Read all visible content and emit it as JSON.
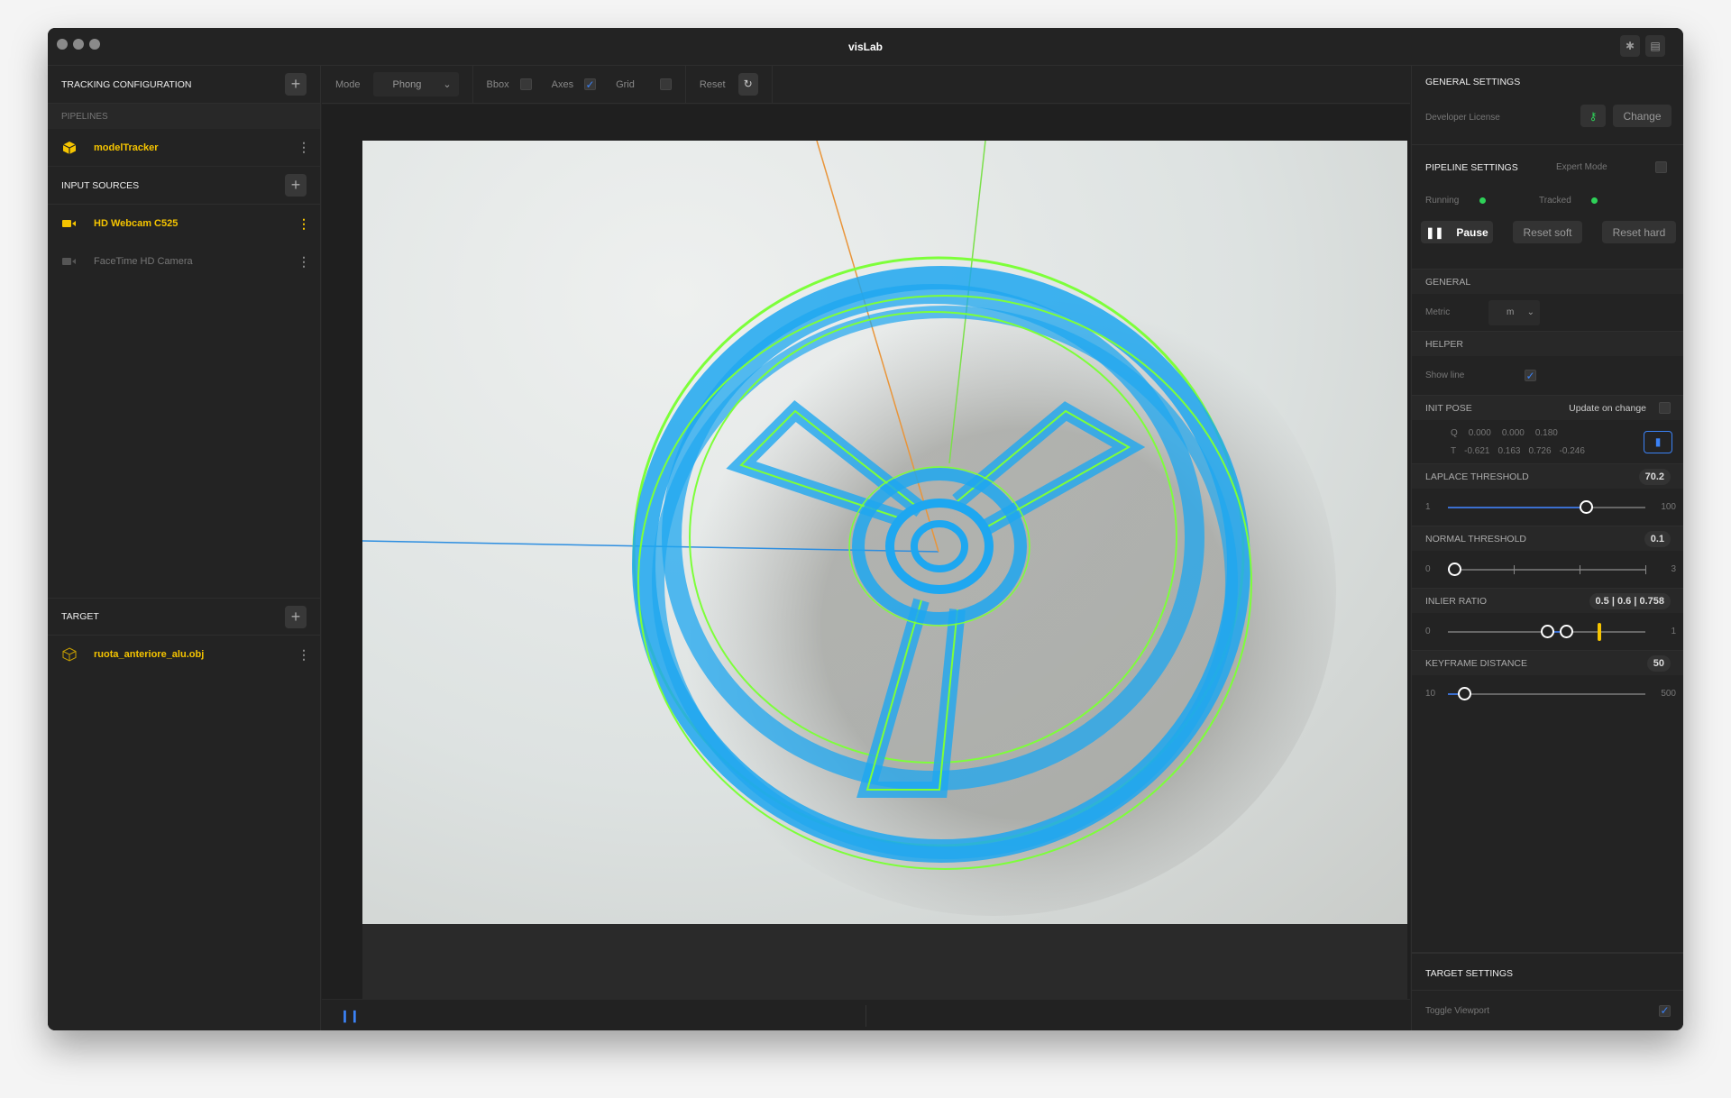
{
  "app": {
    "title": "visLab"
  },
  "titlebar": {
    "icons": [
      "bug-icon",
      "sidebar-icon"
    ]
  },
  "left": {
    "tracking_title": "TRACKING CONFIGURATION",
    "pipelines_label": "PIPELINES",
    "pipelines": [
      {
        "name": "modelTracker",
        "icon": "cube-icon"
      }
    ],
    "input_title": "INPUT SOURCES",
    "inputs": [
      {
        "name": "HD Webcam C525",
        "active": true
      },
      {
        "name": "FaceTime HD Camera",
        "active": false
      }
    ],
    "target_title": "TARGET",
    "targets": [
      {
        "name": "ruota_anteriore_alu.obj"
      }
    ]
  },
  "toolbar": {
    "mode_label": "Mode",
    "mode_value": "Phong",
    "bbox_label": "Bbox",
    "bbox": false,
    "axes_label": "Axes",
    "axes": true,
    "grid_label": "Grid",
    "grid": false,
    "reset_label": "Reset"
  },
  "right": {
    "general_settings": "GENERAL SETTINGS",
    "license_label": "Developer License",
    "change_label": "Change",
    "pipeline_settings": "PIPELINE SETTINGS",
    "expert_mode": "Expert Mode",
    "running": "Running",
    "tracked": "Tracked",
    "pause": "Pause",
    "reset_soft": "Reset soft",
    "reset_hard": "Reset hard",
    "general": "GENERAL",
    "metric_label": "Metric",
    "metric_value": "m",
    "helper": "HELPER",
    "show_line": "Show line",
    "init_pose": "INIT POSE",
    "update_on_change": "Update on change",
    "q_label": "Q",
    "q": [
      "0.000",
      "0.000",
      "0.180"
    ],
    "t_label": "T",
    "t": [
      "-0.621",
      "0.163",
      "0.726",
      "-0.246"
    ],
    "laplace": {
      "title": "LAPLACE THRESHOLD",
      "value": "70.2",
      "min": "1",
      "max": "100"
    },
    "normal": {
      "title": "NORMAL THRESHOLD",
      "value": "0.1",
      "min": "0",
      "max": "3"
    },
    "inlier": {
      "title": "INLIER RATIO",
      "value": "0.5 | 0.6 | 0.758",
      "min": "0",
      "max": "1"
    },
    "keyframe": {
      "title": "KEYFRAME DISTANCE",
      "value": "50",
      "min": "10",
      "max": "500"
    },
    "target_settings": "TARGET SETTINGS",
    "toggle_viewport": "Toggle Viewport"
  },
  "colors": {
    "accent": "#f5c400",
    "blue": "#3b82f6",
    "green": "#2ed158",
    "mesh": "#1ea7f0",
    "edge": "#7dff3a"
  }
}
